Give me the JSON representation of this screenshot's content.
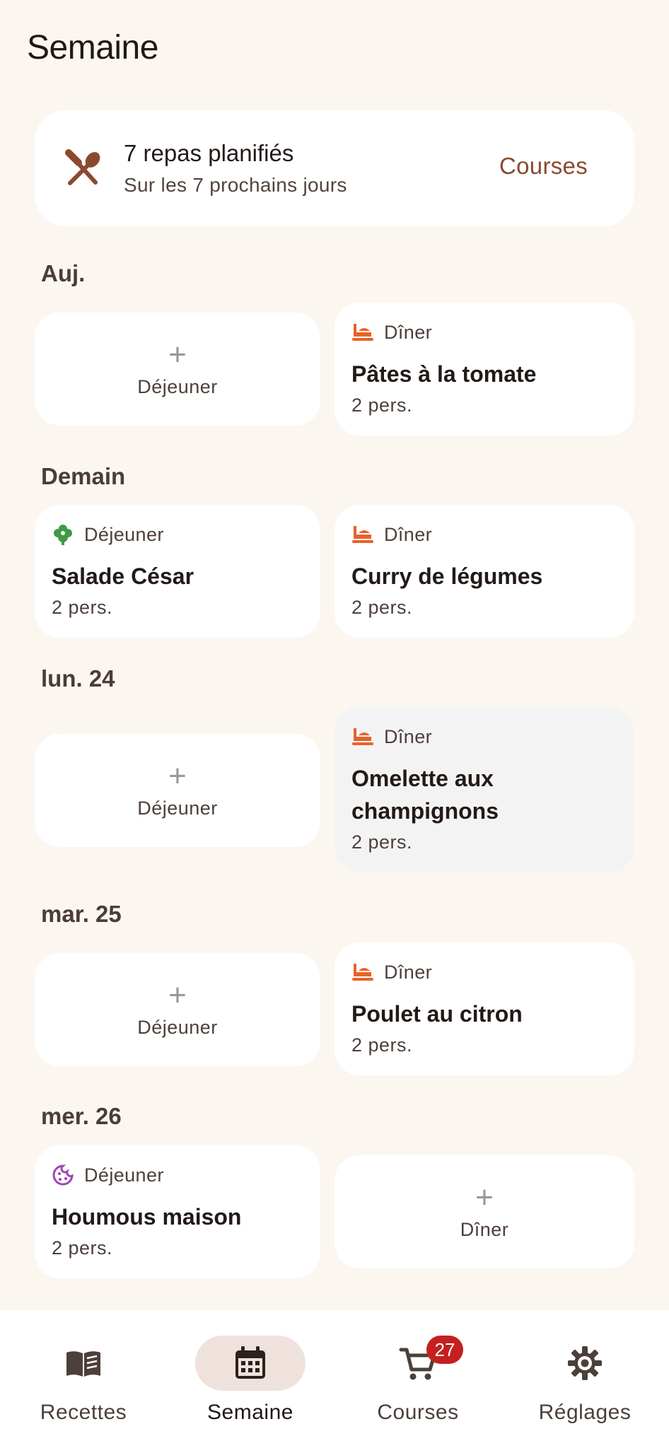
{
  "header": {
    "title": "Semaine"
  },
  "summary": {
    "icon": "utensils-icon",
    "title": "7 repas planifiés",
    "subtitle": "Sur les 7 prochains jours",
    "action_label": "Courses"
  },
  "days": [
    {
      "label": "Auj.",
      "lunch": {
        "empty": true,
        "label": "Déjeuner"
      },
      "dinner": {
        "empty": false,
        "type": "Dîner",
        "icon": "ramen-icon",
        "name": "Pâtes à la tomate",
        "servings": "2 pers."
      }
    },
    {
      "label": "Demain",
      "lunch": {
        "empty": false,
        "type": "Déjeuner",
        "icon": "salad-icon",
        "name": "Salade César",
        "servings": "2 pers."
      },
      "dinner": {
        "empty": false,
        "type": "Dîner",
        "icon": "ramen-icon",
        "name": "Curry de légumes",
        "servings": "2 pers."
      }
    },
    {
      "label": "lun. 24",
      "lunch": {
        "empty": true,
        "label": "Déjeuner"
      },
      "dinner": {
        "empty": false,
        "type": "Dîner",
        "icon": "ramen-icon",
        "name": "Omelette aux champignons",
        "servings": "2 pers."
      }
    },
    {
      "label": "mar. 25",
      "lunch": {
        "empty": true,
        "label": "Déjeuner"
      },
      "dinner": {
        "empty": false,
        "type": "Dîner",
        "icon": "ramen-icon",
        "name": "Poulet au citron",
        "servings": "2 pers."
      }
    },
    {
      "label": "mer. 26",
      "lunch": {
        "empty": false,
        "type": "Déjeuner",
        "icon": "cookie-icon",
        "name": "Houmous maison",
        "servings": "2 pers."
      },
      "dinner": {
        "empty": true,
        "label": "Dîner"
      }
    }
  ],
  "bottom_nav": {
    "items": [
      {
        "label": "Recettes",
        "icon": "book-icon",
        "active": false
      },
      {
        "label": "Semaine",
        "icon": "calendar-icon",
        "active": true
      },
      {
        "label": "Courses",
        "icon": "cart-icon",
        "active": false,
        "badge": "27"
      },
      {
        "label": "Réglages",
        "icon": "gear-icon",
        "active": false
      }
    ]
  },
  "colors": {
    "background": "#fcf6f1",
    "accent": "#8a4a2e",
    "dinner_icon": "#e8622a",
    "lunch_icon_salad": "#3f9a45",
    "lunch_icon_cookie": "#a046b3",
    "badge": "#c4201f",
    "nav_active": "#efe2dd"
  }
}
